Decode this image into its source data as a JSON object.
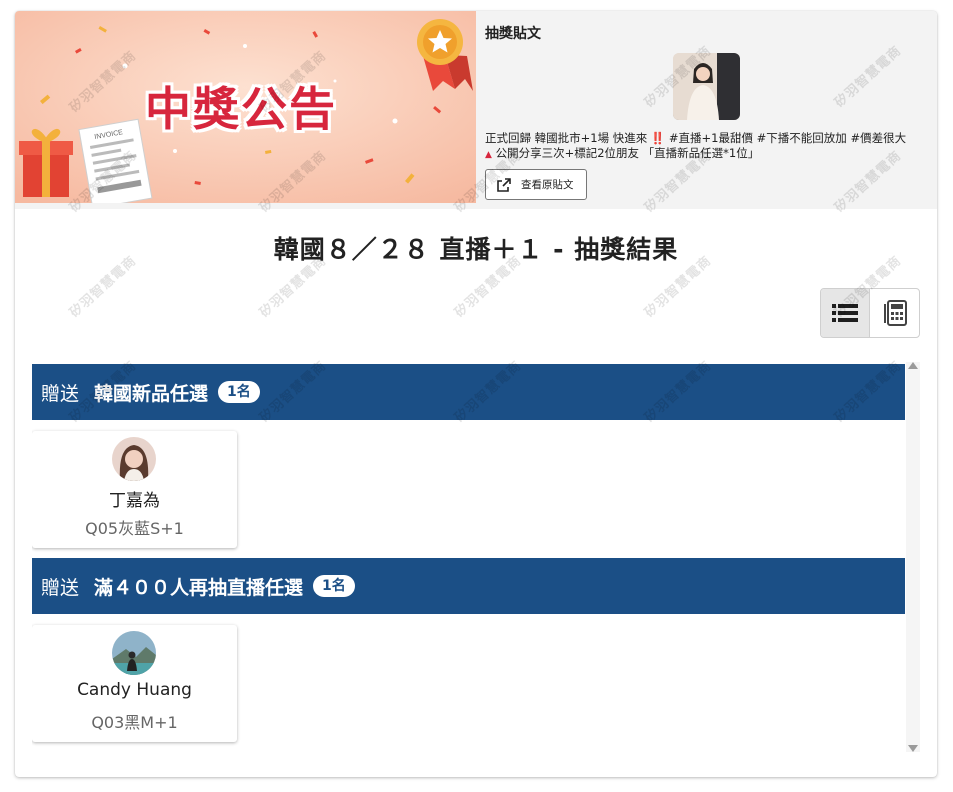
{
  "banner": {
    "title": "中獎公告",
    "invoice_label": "INVOICE"
  },
  "post": {
    "label": "抽獎貼文",
    "text_line1_start": "正式回歸 韓國批市+1場 快進來",
    "text_line1_mark": "‼️",
    "text_line1_end": " #直播+1最甜價 #下播不能回放加 #價差很大",
    "text_line2_mark": "▲",
    "text_line2_end": " 公開分享三次+標記2位朋友 「直播新品任選*1位」",
    "view_button_label": "查看原貼文",
    "view_button_icon": "external-link-icon"
  },
  "main_title": "韓國８／２８ 直播＋１ - 抽獎結果",
  "view_toggle": {
    "options": [
      {
        "name": "list-view",
        "icon": "list-icon",
        "active": true
      },
      {
        "name": "grid-view",
        "icon": "calculator-grid-icon",
        "active": false
      }
    ]
  },
  "prizes": [
    {
      "give_label": "贈送",
      "name": "韓國新品任選",
      "count_label": "1名",
      "winners": [
        {
          "name": "丁嘉為",
          "item": "Q05灰藍S+1"
        }
      ]
    },
    {
      "give_label": "贈送",
      "name": "滿４００人再抽直播任選",
      "count_label": "1名",
      "winners": [
        {
          "name": "Candy Huang",
          "item": "Q03黑M+1"
        }
      ]
    }
  ],
  "watermark_text": "矽羽智慧電商",
  "colors": {
    "prize_bar": "#1b4f86",
    "banner_title": "#d7263d",
    "header_bg": "#f3f3f3"
  }
}
